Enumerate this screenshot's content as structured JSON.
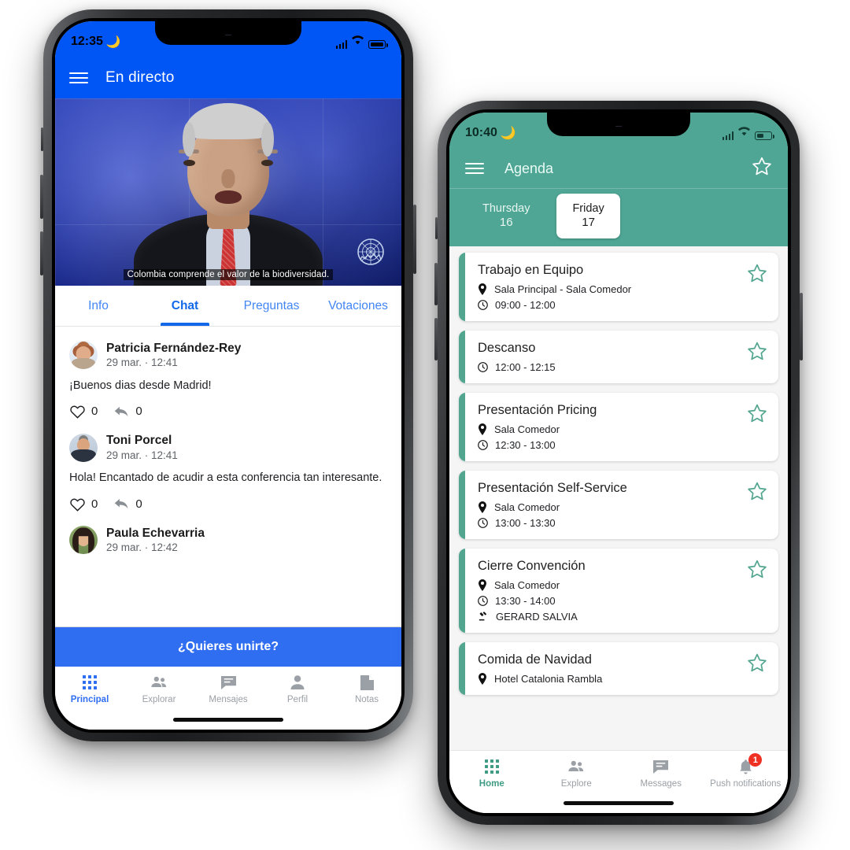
{
  "phone_live": {
    "status_bar": {
      "time": "12:35",
      "moon_icon": "crescent-moon-icon"
    },
    "app_bar": {
      "menu_icon": "hamburger-menu-icon",
      "title": "En directo"
    },
    "video": {
      "caption": "Colombia comprende el valor de la biodiversidad.",
      "logo": "un-emblem-icon"
    },
    "tabs": [
      {
        "label": "Info",
        "active": false
      },
      {
        "label": "Chat",
        "active": true
      },
      {
        "label": "Preguntas",
        "active": false
      },
      {
        "label": "Votaciones",
        "active": false
      }
    ],
    "messages": [
      {
        "name": "Patricia Fernández-Rey",
        "time": "29 mar. · 12:41",
        "text": "¡Buenos dias desde Madrid!",
        "likes": "0",
        "replies": "0"
      },
      {
        "name": "Toni Porcel",
        "time": "29 mar. · 12:41",
        "text": "Hola! Encantado de acudir a esta conferencia tan interesante.",
        "likes": "0",
        "replies": "0"
      },
      {
        "name": "Paula Echevarria",
        "time": "29 mar. · 12:42",
        "text": "",
        "likes": "",
        "replies": ""
      }
    ],
    "join_button": "¿Quieres unirte?",
    "bottom_nav": [
      {
        "label": "Principal",
        "icon": "grid-icon",
        "active": true
      },
      {
        "label": "Explorar",
        "icon": "people-icon",
        "active": false
      },
      {
        "label": "Mensajes",
        "icon": "chat-bubble-icon",
        "active": false
      },
      {
        "label": "Perfil",
        "icon": "person-icon",
        "active": false
      },
      {
        "label": "Notas",
        "icon": "document-icon",
        "active": false
      }
    ],
    "colors": {
      "accent": "#0055F5",
      "join_button": "#2f6df1",
      "tab_active": "#1268e8"
    }
  },
  "phone_agenda": {
    "status_bar": {
      "time": "10:40",
      "moon_icon": "crescent-moon-icon"
    },
    "app_bar": {
      "menu_icon": "hamburger-menu-icon",
      "title": "Agenda",
      "star_icon": "star-outline-icon"
    },
    "days": [
      {
        "name": "Thursday",
        "number": "16",
        "active": false
      },
      {
        "name": "Friday",
        "number": "17",
        "active": true
      }
    ],
    "events": [
      {
        "title": "Trabajo en Equipo",
        "location": "Sala Principal - Sala Comedor",
        "time": "09:00 - 12:00",
        "speaker": ""
      },
      {
        "title": "Descanso",
        "location": "",
        "time": "12:00 - 12:15",
        "speaker": ""
      },
      {
        "title": "Presentación Pricing",
        "location": "Sala Comedor",
        "time": "12:30 - 13:00",
        "speaker": ""
      },
      {
        "title": "Presentación Self-Service",
        "location": "Sala Comedor",
        "time": "13:00 - 13:30",
        "speaker": ""
      },
      {
        "title": "Cierre Convención",
        "location": "Sala Comedor",
        "time": "13:30 - 14:00",
        "speaker": "GERARD SALVIA"
      },
      {
        "title": "Comida de Navidad",
        "location": "Hotel Catalonia Rambla",
        "time": "",
        "speaker": ""
      }
    ],
    "bottom_nav": [
      {
        "label": "Home",
        "icon": "grid-icon",
        "active": true,
        "badge": ""
      },
      {
        "label": "Explore",
        "icon": "people-icon",
        "active": false,
        "badge": ""
      },
      {
        "label": "Messages",
        "icon": "chat-bubble-icon",
        "active": false,
        "badge": ""
      },
      {
        "label": "Push notifications",
        "icon": "bell-icon",
        "active": false,
        "badge": "1"
      }
    ],
    "colors": {
      "accent": "#4FA695",
      "card_bar": "#52A58F",
      "badge": "#ef3124"
    }
  }
}
